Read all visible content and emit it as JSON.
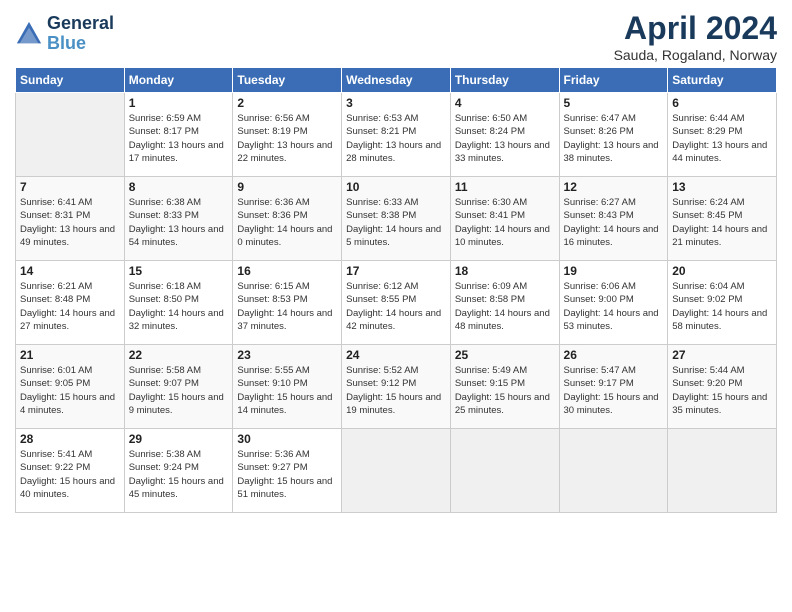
{
  "header": {
    "logo_line1": "General",
    "logo_line2": "Blue",
    "title": "April 2024",
    "subtitle": "Sauda, Rogaland, Norway"
  },
  "weekdays": [
    "Sunday",
    "Monday",
    "Tuesday",
    "Wednesday",
    "Thursday",
    "Friday",
    "Saturday"
  ],
  "weeks": [
    [
      {
        "day": "",
        "info": ""
      },
      {
        "day": "1",
        "info": "Sunrise: 6:59 AM\nSunset: 8:17 PM\nDaylight: 13 hours\nand 17 minutes."
      },
      {
        "day": "2",
        "info": "Sunrise: 6:56 AM\nSunset: 8:19 PM\nDaylight: 13 hours\nand 22 minutes."
      },
      {
        "day": "3",
        "info": "Sunrise: 6:53 AM\nSunset: 8:21 PM\nDaylight: 13 hours\nand 28 minutes."
      },
      {
        "day": "4",
        "info": "Sunrise: 6:50 AM\nSunset: 8:24 PM\nDaylight: 13 hours\nand 33 minutes."
      },
      {
        "day": "5",
        "info": "Sunrise: 6:47 AM\nSunset: 8:26 PM\nDaylight: 13 hours\nand 38 minutes."
      },
      {
        "day": "6",
        "info": "Sunrise: 6:44 AM\nSunset: 8:29 PM\nDaylight: 13 hours\nand 44 minutes."
      }
    ],
    [
      {
        "day": "7",
        "info": "Sunrise: 6:41 AM\nSunset: 8:31 PM\nDaylight: 13 hours\nand 49 minutes."
      },
      {
        "day": "8",
        "info": "Sunrise: 6:38 AM\nSunset: 8:33 PM\nDaylight: 13 hours\nand 54 minutes."
      },
      {
        "day": "9",
        "info": "Sunrise: 6:36 AM\nSunset: 8:36 PM\nDaylight: 14 hours\nand 0 minutes."
      },
      {
        "day": "10",
        "info": "Sunrise: 6:33 AM\nSunset: 8:38 PM\nDaylight: 14 hours\nand 5 minutes."
      },
      {
        "day": "11",
        "info": "Sunrise: 6:30 AM\nSunset: 8:41 PM\nDaylight: 14 hours\nand 10 minutes."
      },
      {
        "day": "12",
        "info": "Sunrise: 6:27 AM\nSunset: 8:43 PM\nDaylight: 14 hours\nand 16 minutes."
      },
      {
        "day": "13",
        "info": "Sunrise: 6:24 AM\nSunset: 8:45 PM\nDaylight: 14 hours\nand 21 minutes."
      }
    ],
    [
      {
        "day": "14",
        "info": "Sunrise: 6:21 AM\nSunset: 8:48 PM\nDaylight: 14 hours\nand 27 minutes."
      },
      {
        "day": "15",
        "info": "Sunrise: 6:18 AM\nSunset: 8:50 PM\nDaylight: 14 hours\nand 32 minutes."
      },
      {
        "day": "16",
        "info": "Sunrise: 6:15 AM\nSunset: 8:53 PM\nDaylight: 14 hours\nand 37 minutes."
      },
      {
        "day": "17",
        "info": "Sunrise: 6:12 AM\nSunset: 8:55 PM\nDaylight: 14 hours\nand 42 minutes."
      },
      {
        "day": "18",
        "info": "Sunrise: 6:09 AM\nSunset: 8:58 PM\nDaylight: 14 hours\nand 48 minutes."
      },
      {
        "day": "19",
        "info": "Sunrise: 6:06 AM\nSunset: 9:00 PM\nDaylight: 14 hours\nand 53 minutes."
      },
      {
        "day": "20",
        "info": "Sunrise: 6:04 AM\nSunset: 9:02 PM\nDaylight: 14 hours\nand 58 minutes."
      }
    ],
    [
      {
        "day": "21",
        "info": "Sunrise: 6:01 AM\nSunset: 9:05 PM\nDaylight: 15 hours\nand 4 minutes."
      },
      {
        "day": "22",
        "info": "Sunrise: 5:58 AM\nSunset: 9:07 PM\nDaylight: 15 hours\nand 9 minutes."
      },
      {
        "day": "23",
        "info": "Sunrise: 5:55 AM\nSunset: 9:10 PM\nDaylight: 15 hours\nand 14 minutes."
      },
      {
        "day": "24",
        "info": "Sunrise: 5:52 AM\nSunset: 9:12 PM\nDaylight: 15 hours\nand 19 minutes."
      },
      {
        "day": "25",
        "info": "Sunrise: 5:49 AM\nSunset: 9:15 PM\nDaylight: 15 hours\nand 25 minutes."
      },
      {
        "day": "26",
        "info": "Sunrise: 5:47 AM\nSunset: 9:17 PM\nDaylight: 15 hours\nand 30 minutes."
      },
      {
        "day": "27",
        "info": "Sunrise: 5:44 AM\nSunset: 9:20 PM\nDaylight: 15 hours\nand 35 minutes."
      }
    ],
    [
      {
        "day": "28",
        "info": "Sunrise: 5:41 AM\nSunset: 9:22 PM\nDaylight: 15 hours\nand 40 minutes."
      },
      {
        "day": "29",
        "info": "Sunrise: 5:38 AM\nSunset: 9:24 PM\nDaylight: 15 hours\nand 45 minutes."
      },
      {
        "day": "30",
        "info": "Sunrise: 5:36 AM\nSunset: 9:27 PM\nDaylight: 15 hours\nand 51 minutes."
      },
      {
        "day": "",
        "info": ""
      },
      {
        "day": "",
        "info": ""
      },
      {
        "day": "",
        "info": ""
      },
      {
        "day": "",
        "info": ""
      }
    ]
  ]
}
